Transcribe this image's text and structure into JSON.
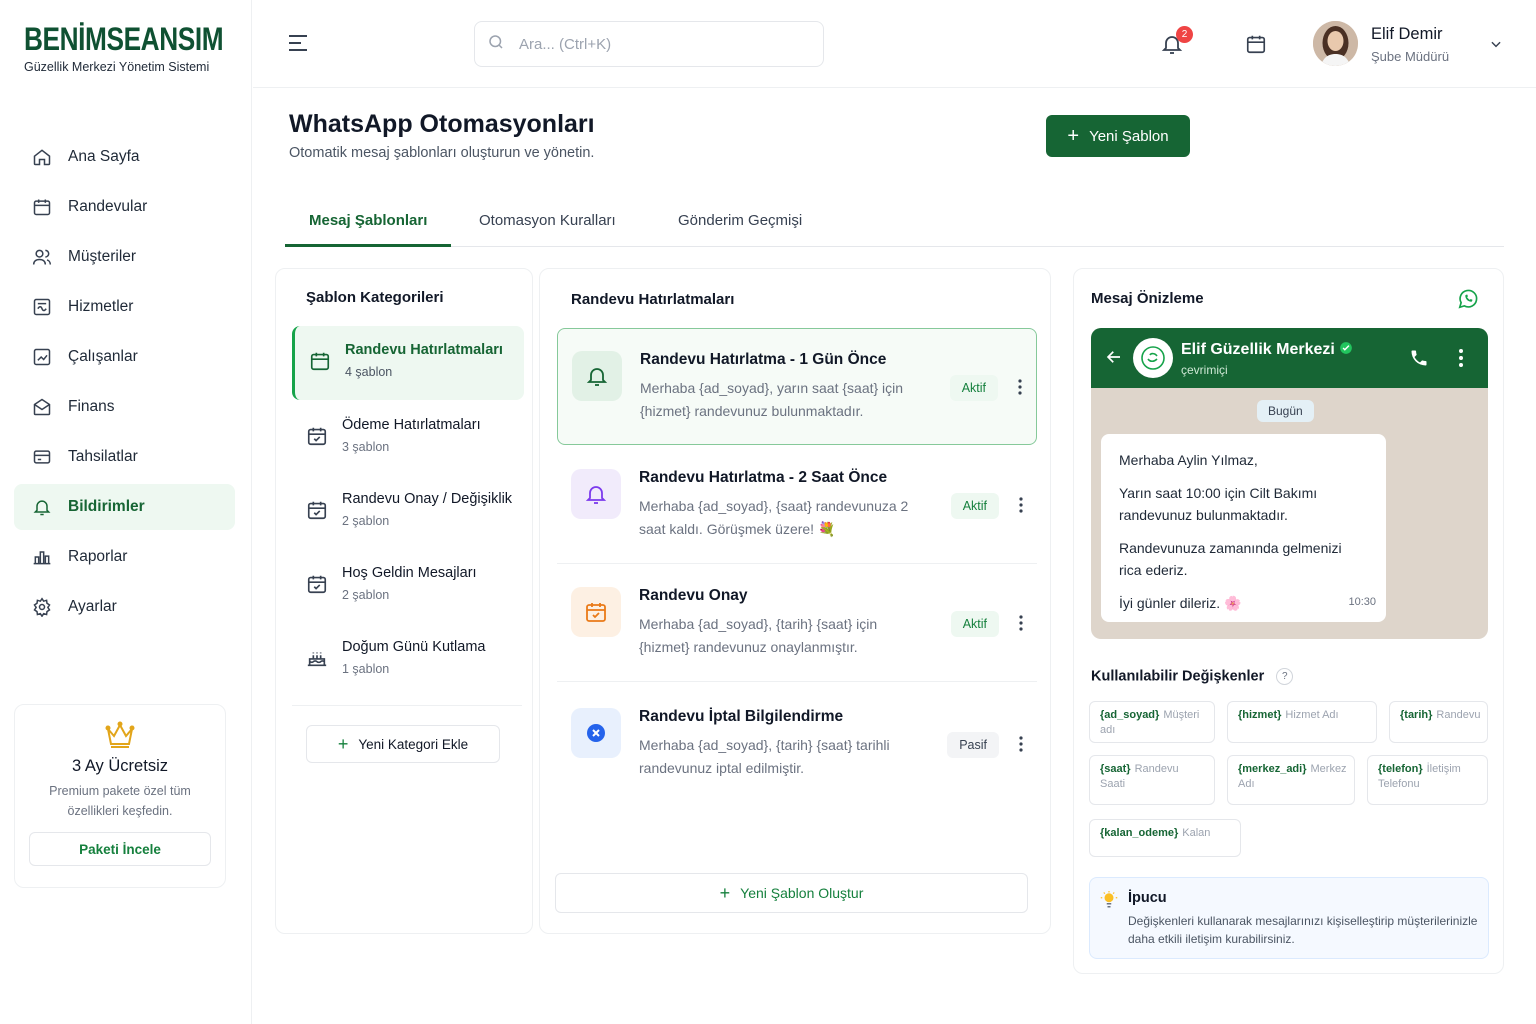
{
  "brand": {
    "name_part1": "BENİM",
    "name_part2": "SEANSIM",
    "subtitle": "Güzellik Merkezi Yönetim Sistemi"
  },
  "sidebar": {
    "items": [
      {
        "label": "Ana Sayfa",
        "icon": "home-icon"
      },
      {
        "label": "Randevular",
        "icon": "calendar-icon"
      },
      {
        "label": "Müşteriler",
        "icon": "users-icon"
      },
      {
        "label": "Hizmetler",
        "icon": "services-icon"
      },
      {
        "label": "Çalışanlar",
        "icon": "staff-icon"
      },
      {
        "label": "Finans",
        "icon": "finance-icon"
      },
      {
        "label": "Tahsilatlar",
        "icon": "card-icon"
      },
      {
        "label": "Bildirimler",
        "icon": "bell-icon",
        "active": true
      },
      {
        "label": "Raporlar",
        "icon": "chart-icon"
      },
      {
        "label": "Ayarlar",
        "icon": "gear-icon"
      }
    ],
    "promo": {
      "title": "3 Ay Ücretsiz",
      "desc": "Premium pakete özel tüm özellikleri keşfedin.",
      "button": "Paketi İncele"
    }
  },
  "topbar": {
    "search_placeholder": "Ara... (Ctrl+K)",
    "notification_count": "2",
    "user": {
      "name": "Elif Demir",
      "role": "Şube Müdürü"
    }
  },
  "header": {
    "title": "WhatsApp Otomasyonları",
    "subtitle": "Otomatik mesaj şablonları oluşturun ve yönetin.",
    "new_button": "Yeni Şablon"
  },
  "tabs": [
    {
      "label": "Mesaj Şablonları",
      "active": true
    },
    {
      "label": "Otomasyon Kuralları"
    },
    {
      "label": "Gönderim Geçmişi"
    }
  ],
  "categories": {
    "title": "Şablon Kategorileri",
    "items": [
      {
        "name": "Randevu Hatırlatmaları",
        "count": "4 şablon",
        "active": true
      },
      {
        "name": "Ödeme Hatırlatmaları",
        "count": "3 şablon"
      },
      {
        "name": "Randevu Onay / Değişiklik",
        "count": "2 şablon"
      },
      {
        "name": "Hoş Geldin Mesajları",
        "count": "2 şablon"
      },
      {
        "name": "Doğum Günü Kutlama",
        "count": "1 şablon"
      }
    ],
    "add_button": "Yeni Kategori Ekle"
  },
  "templates": {
    "title": "Randevu Hatırlatmaları",
    "items": [
      {
        "name": "Randevu Hatırlatma - 1 Gün Önce",
        "body": "Merhaba {ad_soyad}, yarın saat {saat} için {hizmet} randevunuz bulunmaktadır.",
        "status": "Aktif"
      },
      {
        "name": "Randevu Hatırlatma - 2 Saat Önce",
        "body": "Merhaba {ad_soyad}, {saat} randevunuza 2 saat kaldı. Görüşmek üzere! 💐",
        "status": "Aktif"
      },
      {
        "name": "Randevu Onay",
        "body": "Merhaba {ad_soyad}, {tarih} {saat} için {hizmet} randevunuz onaylanmıştır.",
        "status": "Aktif"
      },
      {
        "name": "Randevu İptal Bilgilendirme",
        "body": "Merhaba {ad_soyad}, {tarih} {saat} tarihli randevunuz iptal edilmiştir.",
        "status": "Pasif"
      }
    ],
    "create_button": "Yeni Şablon Oluştur"
  },
  "preview": {
    "title": "Mesaj Önizleme",
    "business_name": "Elif Güzellik Merkezi",
    "business_status": "çevrimiçi",
    "date_label": "Bugün",
    "message": {
      "greeting": "Merhaba Aylin Yılmaz,",
      "line1": "Yarın saat 10:00 için Cilt Bakımı randevunuz bulunmaktadır.",
      "line2": "Randevunuza zamanında gelmenizi rica ederiz.",
      "line3": "İyi günler dileriz. 🌸",
      "time": "10:30"
    },
    "vars_title": "Kullanılabilir Değişkenler",
    "vars": [
      {
        "key": "{ad_soyad}",
        "desc": "Müşteri adı"
      },
      {
        "key": "{hizmet}",
        "desc": "Hizmet Adı"
      },
      {
        "key": "{tarih}",
        "desc": "Randevu"
      },
      {
        "key": "{saat}",
        "desc": "Randevu Saati"
      },
      {
        "key": "{merkez_adi}",
        "desc": "Merkez Adı"
      },
      {
        "key": "{telefon}",
        "desc": "İletişim Telefonu"
      },
      {
        "key": "{kalan_odeme}",
        "desc": "Kalan"
      }
    ],
    "tip": {
      "title": "İpucu",
      "body": "Değişkenleri kullanarak mesajlarınızı kişiselleştirip müşterilerinizle daha etkili iletişim kurabilirsiniz."
    }
  },
  "colors": {
    "primary": "#166534",
    "accent": "#16a34a",
    "gold": "#e2a51a"
  }
}
